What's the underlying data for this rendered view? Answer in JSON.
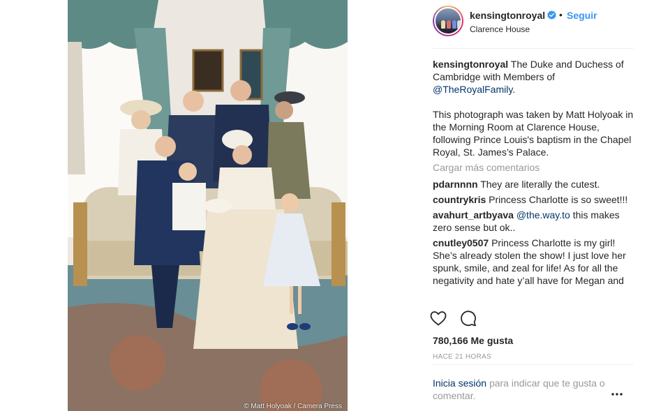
{
  "photo": {
    "credit": "© Matt Holyoak / Camera Press"
  },
  "header": {
    "username": "kensingtonroyal",
    "separator": "•",
    "follow_label": "Seguir",
    "location": "Clarence House",
    "avatar_icon": "royal-avatar-icon",
    "verified_icon": "verified-badge-icon"
  },
  "caption": {
    "username": "kensingtonroyal",
    "text_1": "The Duke and Duchess of Cambridge with Members of",
    "mention": "@TheRoyalFamily",
    "text_1_end": ".",
    "text_2": "This photograph was taken by Matt Holyoak in the Morning Room at Clarence House, following Prince Louis's baptism in the Chapel Royal, St. James’s Palace."
  },
  "load_more_label": "Cargar más comentarios",
  "comments": [
    {
      "username": "pdarnnnn",
      "text": "They are literally the cutest."
    },
    {
      "username": "countrykris",
      "text": "Princess Charlotte is so sweet!!!"
    },
    {
      "username": "avahurt_artbyava",
      "mention": "@the.way.to",
      "text": "this makes zero sense but ok.."
    },
    {
      "username": "cnutley0507",
      "text": "Princess Charlotte is my girl! She’s already stolen the show! I just love her spunk, smile, and zeal for life! As for all the negativity and hate y’all have for Megan and"
    }
  ],
  "actions": {
    "like_icon": "heart-icon",
    "comment_icon": "comment-bubble-icon",
    "more_icon": "more-dots-icon"
  },
  "likes_label": "780,166 Me gusta",
  "timestamp": "HACE 21 HORAS",
  "login": {
    "link": "Inicia sesión",
    "text": "para indicar que te gusta o comentar."
  },
  "colors": {
    "accent": "#3897f0",
    "mention": "#003569",
    "muted": "#999999",
    "text": "#262626"
  }
}
